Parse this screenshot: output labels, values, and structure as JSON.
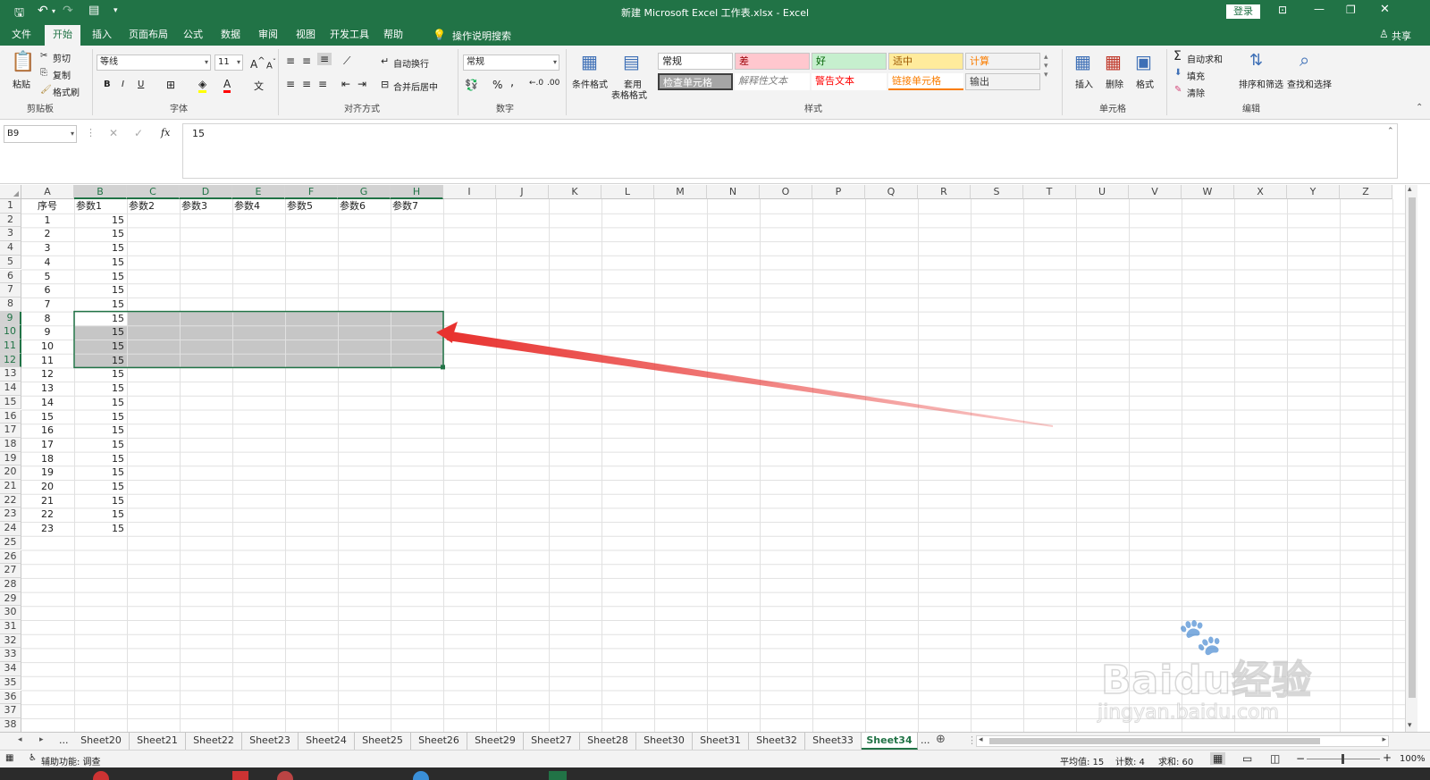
{
  "window": {
    "title": "新建 Microsoft Excel 工作表.xlsx  -  Excel",
    "login": "登录",
    "share": "共享"
  },
  "tabs": [
    "文件",
    "开始",
    "插入",
    "页面布局",
    "公式",
    "数据",
    "审阅",
    "视图",
    "开发工具",
    "帮助"
  ],
  "active_tab": "开始",
  "tell_me": "操作说明搜索",
  "ribbon": {
    "clipboard": {
      "paste": "粘贴",
      "cut": "剪切",
      "copy": "复制",
      "format_painter": "格式刷",
      "group": "剪贴板"
    },
    "font": {
      "name": "等线",
      "size": "11",
      "bold": "B",
      "italic": "I",
      "underline": "U",
      "group": "字体"
    },
    "align": {
      "wrap": "自动换行",
      "merge": "合并后居中",
      "group": "对齐方式"
    },
    "number": {
      "format": "常规",
      "percent": "%",
      "comma": ",",
      "group": "数字"
    },
    "styles": {
      "cond": "条件格式",
      "table1": "套用",
      "table2": "表格格式",
      "group": "样式",
      "cells": [
        {
          "label": "常规",
          "bg": "#ffffff",
          "fg": "#222222"
        },
        {
          "label": "差",
          "bg": "#ffc7ce",
          "fg": "#9c0006"
        },
        {
          "label": "好",
          "bg": "#c6efce",
          "fg": "#006100"
        },
        {
          "label": "适中",
          "bg": "#ffeb9c",
          "fg": "#9c5700"
        },
        {
          "label": "计算",
          "bg": "#f2f2f2",
          "fg": "#fa7d00"
        },
        {
          "label": "检查单元格",
          "bg": "#a5a5a5",
          "fg": "#ffffff"
        },
        {
          "label": "解释性文本",
          "bg": "#ffffff",
          "fg": "#7f7f7f"
        },
        {
          "label": "警告文本",
          "bg": "#ffffff",
          "fg": "#ff0000"
        },
        {
          "label": "链接单元格",
          "bg": "#ffffff",
          "fg": "#fa7d00"
        },
        {
          "label": "输出",
          "bg": "#f2f2f2",
          "fg": "#3f3f3f"
        }
      ]
    },
    "cells_grp": {
      "insert": "插入",
      "delete": "删除",
      "format": "格式",
      "group": "单元格"
    },
    "editing": {
      "autosum": "自动求和",
      "fill": "填充",
      "clear": "清除",
      "sort": "排序和筛选",
      "find": "查找和选择",
      "group": "编辑"
    }
  },
  "formula_bar": {
    "name_box": "B9",
    "fx": "fx",
    "value": "15"
  },
  "columns": [
    "A",
    "B",
    "C",
    "D",
    "E",
    "F",
    "G",
    "H",
    "I",
    "J",
    "K",
    "L",
    "M",
    "N",
    "O",
    "P",
    "Q",
    "R",
    "S",
    "T",
    "U",
    "V",
    "W",
    "X",
    "Y",
    "Z"
  ],
  "row_numbers": [
    "1",
    "2",
    "3",
    "4",
    "5",
    "6",
    "7",
    "8",
    "9",
    "10",
    "11",
    "12",
    "13",
    "14",
    "15",
    "16",
    "17",
    "18",
    "19",
    "20",
    "21",
    "22",
    "23",
    "24",
    "25",
    "26",
    "27",
    "28",
    "29",
    "30",
    "31",
    "32",
    "33",
    "34",
    "35",
    "36",
    "37",
    "38"
  ],
  "header_row": [
    "序号",
    "参数1",
    "参数2",
    "参数3",
    "参数4",
    "参数5",
    "参数6",
    "参数7"
  ],
  "data_rows": [
    [
      "1",
      "15"
    ],
    [
      "2",
      "15"
    ],
    [
      "3",
      "15"
    ],
    [
      "4",
      "15"
    ],
    [
      "5",
      "15"
    ],
    [
      "6",
      "15"
    ],
    [
      "7",
      "15"
    ],
    [
      "8",
      "15"
    ],
    [
      "9",
      "15"
    ],
    [
      "10",
      "15"
    ],
    [
      "11",
      "15"
    ],
    [
      "12",
      "15"
    ],
    [
      "13",
      "15"
    ],
    [
      "14",
      "15"
    ],
    [
      "15",
      "15"
    ],
    [
      "16",
      "15"
    ],
    [
      "17",
      "15"
    ],
    [
      "18",
      "15"
    ],
    [
      "19",
      "15"
    ],
    [
      "20",
      "15"
    ],
    [
      "21",
      "15"
    ],
    [
      "22",
      "15"
    ],
    [
      "23",
      "15"
    ]
  ],
  "selection": "B9:H12",
  "sheets": [
    "Sheet20",
    "Sheet21",
    "Sheet22",
    "Sheet23",
    "Sheet24",
    "Sheet25",
    "Sheet26",
    "Sheet29",
    "Sheet27",
    "Sheet28",
    "Sheet30",
    "Sheet31",
    "Sheet32",
    "Sheet33",
    "Sheet34"
  ],
  "active_sheet": "Sheet34",
  "sheet_more": "...",
  "status": {
    "accessibility": "辅助功能: 调查",
    "average": "平均值: 15",
    "count": "计数: 4",
    "sum": "求和: 60",
    "zoom": "100%"
  },
  "watermark": {
    "brand": "Baidu经验",
    "url": "jingyan.baidu.com"
  },
  "colors": {
    "excel_green": "#217346",
    "arrow": "#e8322f",
    "selection_fill": "#c6c6c6"
  }
}
